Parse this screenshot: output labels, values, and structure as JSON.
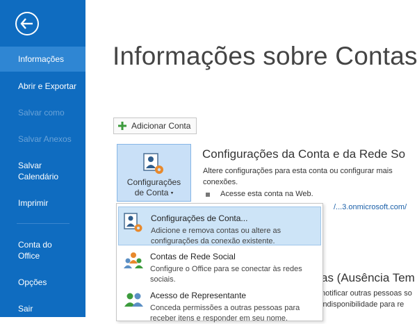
{
  "sidebar": {
    "items": [
      {
        "label": "Informações"
      },
      {
        "label": "Abrir e Exportar"
      },
      {
        "label": "Salvar como"
      },
      {
        "label": "Salvar Anexos"
      },
      {
        "label": "Salvar Calendário"
      },
      {
        "label": "Imprimir"
      },
      {
        "label": "Conta do Office"
      },
      {
        "label": "Opções"
      },
      {
        "label": "Sair"
      }
    ]
  },
  "main": {
    "title": "Informações sobre Contas",
    "add_account_label": "Adicionar Conta",
    "account_settings_button": {
      "line1": "Configurações",
      "line2": "de Conta"
    },
    "section_title": "Configurações da Conta e da Rede So",
    "section_desc": "Altere configurações para esta conta ou configurar mais conexões.",
    "bullet_text": "Acesse esta conta na Web.",
    "link_text": "/...3.onmicrosoft.com/",
    "oof_title": "as (Ausência Tem",
    "oof_line1": "notificar outras pessoas so",
    "oof_line2": "indisponibilidade para re"
  },
  "dropdown": {
    "items": [
      {
        "title": "Configurações de Conta...",
        "desc": "Adicione e remova contas ou altere as configurações da conexão existente."
      },
      {
        "title": "Contas de Rede Social",
        "desc": "Configure o Office para se conectar às redes sociais."
      },
      {
        "title": "Acesso de Representante",
        "desc": "Conceda permissões a outras pessoas para receber itens e responder em seu nome."
      }
    ]
  },
  "colors": {
    "sidebar_bg": "#0f6cc0",
    "sidebar_active": "#2f86d3",
    "hover_bg": "#cde4f7",
    "accent_orange": "#e8892c"
  }
}
